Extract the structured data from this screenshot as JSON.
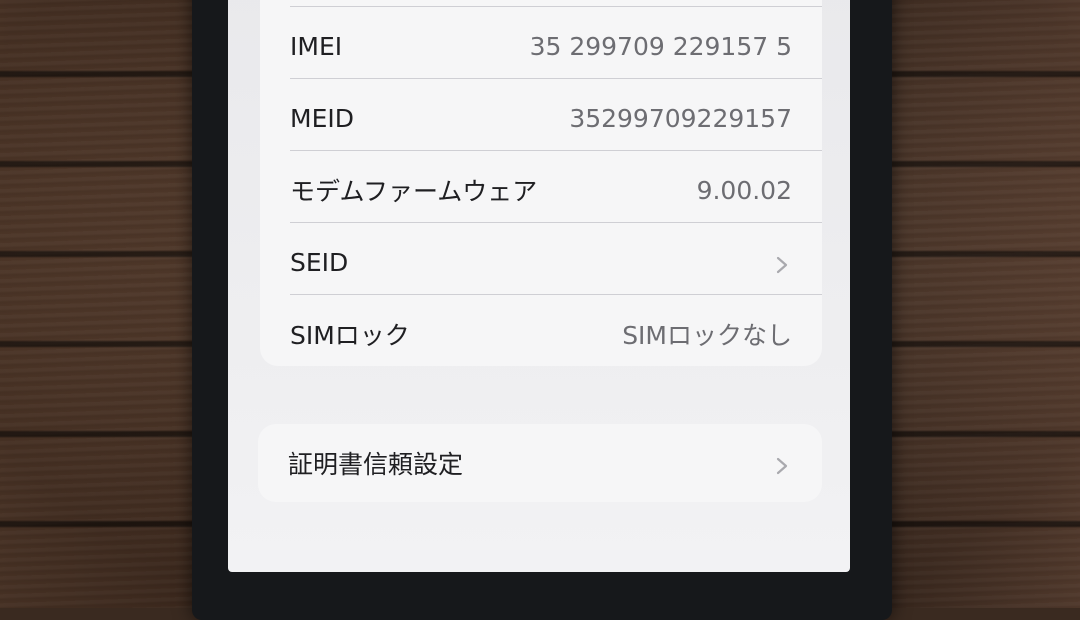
{
  "settings_list": {
    "rows": [
      {
        "label": "IMEI",
        "value": "35 299709 229157 5"
      },
      {
        "label": "MEID",
        "value": "35299709229157"
      },
      {
        "label": "モデムファームウェア",
        "value": "9.00.02"
      },
      {
        "label": "SEID",
        "value": "",
        "icon": "chevron-right-icon"
      },
      {
        "label": "SIMロック",
        "value": "SIMロックなし"
      }
    ]
  },
  "cert_group": {
    "label": "証明書信頼設定",
    "icon": "chevron-right-icon"
  },
  "colors": {
    "screen_bg": "#eeeef0",
    "group_bg": "#f6f6f7",
    "label_text": "#1f1f22",
    "value_text": "#6d6d72",
    "bezel": "#16181b"
  }
}
